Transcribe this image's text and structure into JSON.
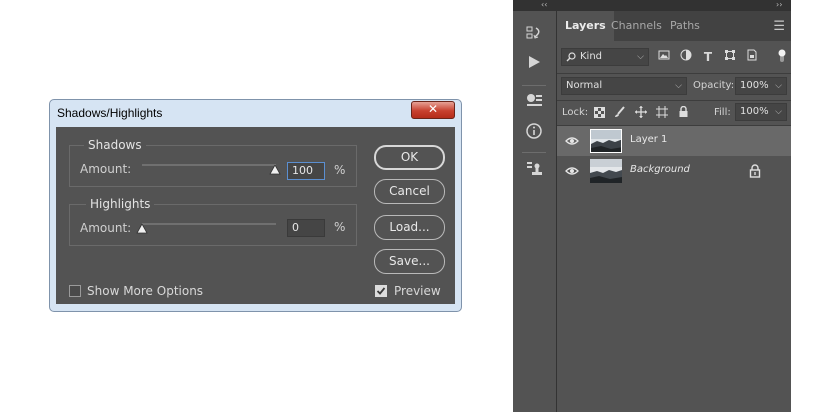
{
  "dialog": {
    "title": "Shadows/Highlights",
    "close_glyph": "✕",
    "shadows": {
      "title": "Shadows",
      "amount_label": "Amount:",
      "value": "100",
      "unit": "%",
      "slider_level": 1.0
    },
    "highlights": {
      "title": "Highlights",
      "amount_label": "Amount:",
      "value": "0",
      "unit": "%",
      "slider_level": 0.0
    },
    "buttons": {
      "ok": "OK",
      "cancel": "Cancel",
      "load": "Load...",
      "save": "Save..."
    },
    "show_more_options": {
      "label": "Show More Options",
      "checked": false
    },
    "preview": {
      "label": "Preview",
      "checked": true
    }
  },
  "panel": {
    "collapse_left": "‹‹",
    "collapse_right": "››",
    "tabs": [
      "Layers",
      "Channels",
      "Paths"
    ],
    "active_tab": "Layers",
    "filter_kind": "Kind",
    "blend_mode": "Normal",
    "opacity_label": "Opacity:",
    "opacity_value": "100%",
    "lock_label": "Lock:",
    "fill_label": "Fill:",
    "fill_value": "100%",
    "layers": [
      {
        "name": "Layer 1",
        "selected": true,
        "visible": true,
        "locked": false
      },
      {
        "name": "Background",
        "selected": false,
        "visible": true,
        "locked": true,
        "italic": true
      }
    ]
  },
  "colors": {
    "dialog_frame": "#d6e4f3",
    "dialog_body": "#535353",
    "close_button": "#c8412f",
    "panel_bg": "#535353",
    "selected_layer": "#696969",
    "focus_border": "#5b8fd1"
  }
}
